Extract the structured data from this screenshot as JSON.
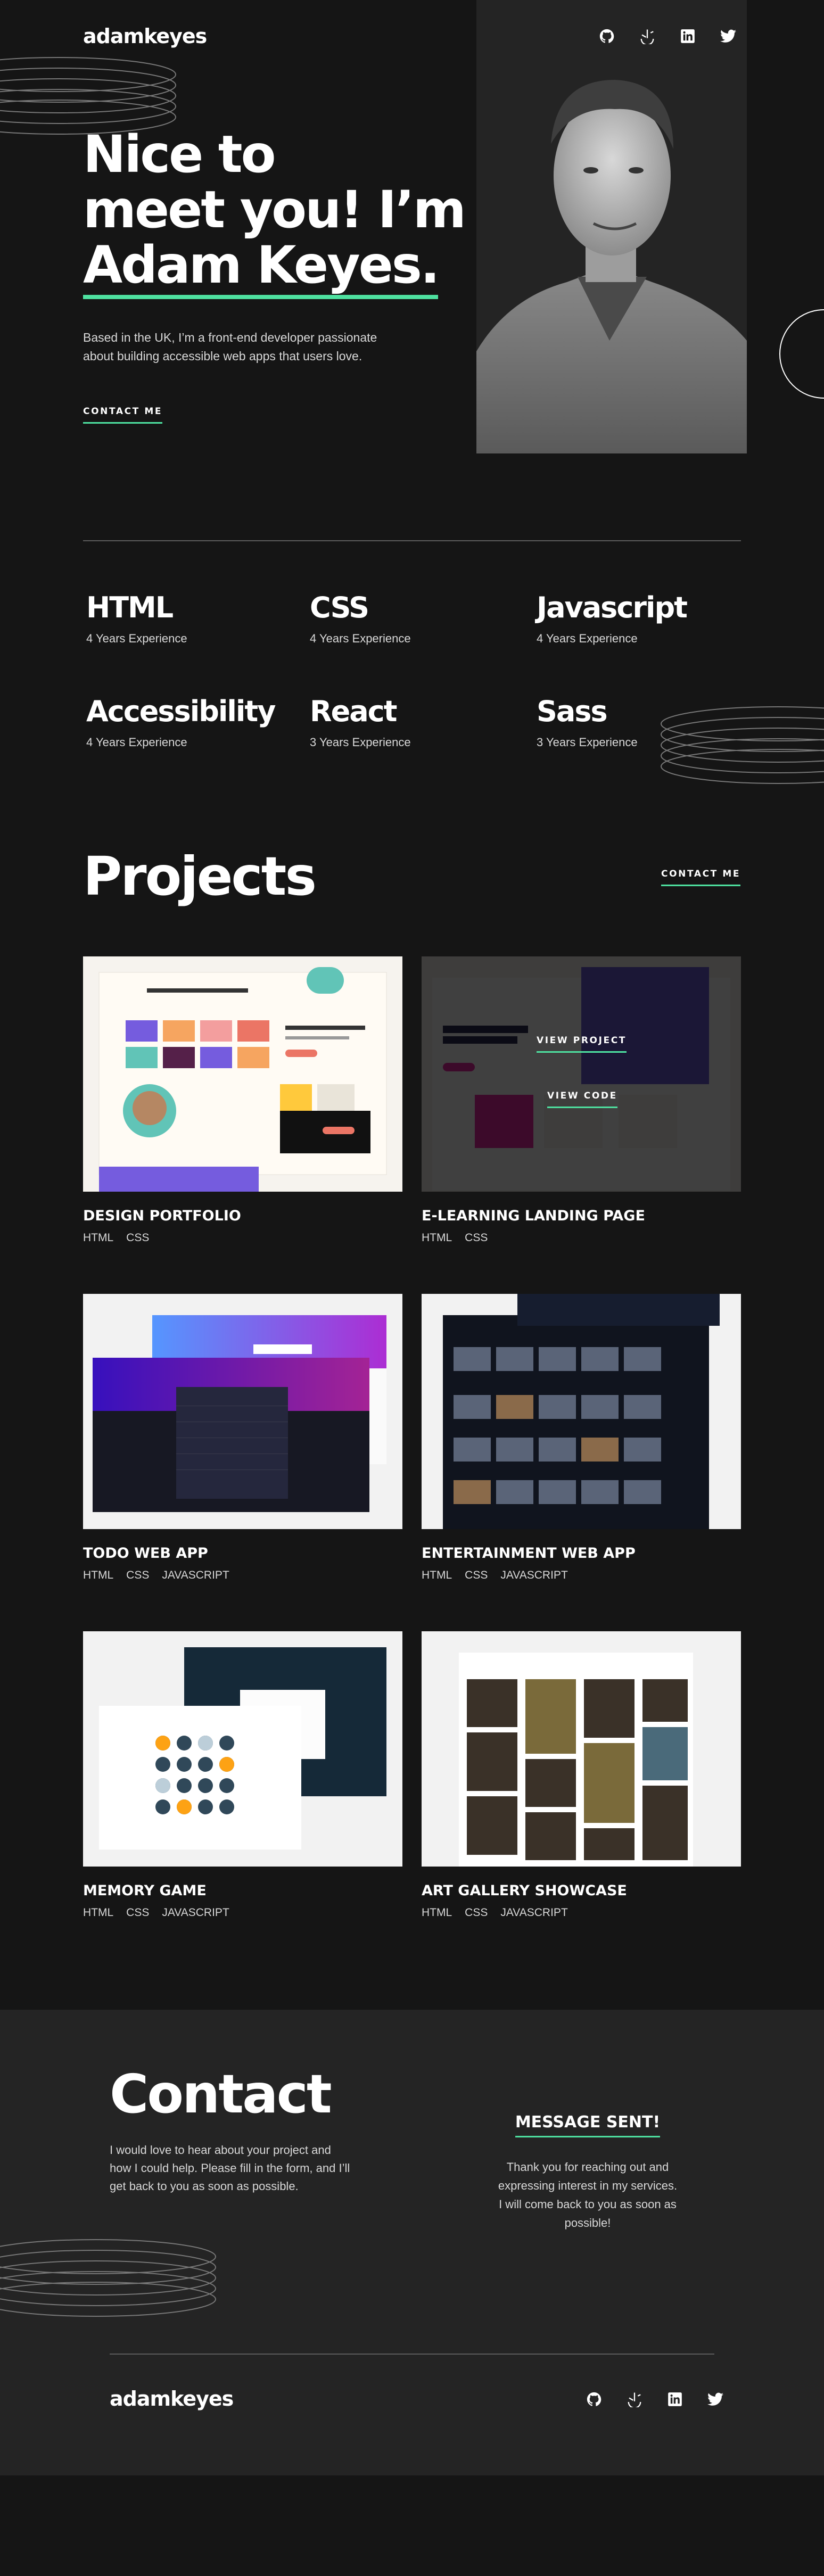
{
  "header": {
    "logo": "adamkeyes",
    "social": [
      "github-icon",
      "frontend-mentor-icon",
      "linkedin-icon",
      "twitter-icon"
    ]
  },
  "hero": {
    "line1": "Nice to",
    "line2": "meet you! I’m",
    "name": "Adam Keyes.",
    "description_line1": "Based in the UK, I’m a front-end developer passionate",
    "description_line2": "about building accessible web apps that users love.",
    "cta": "CONTACT ME"
  },
  "skills": [
    {
      "name": "HTML",
      "experience": "4 Years Experience"
    },
    {
      "name": "CSS",
      "experience": "4 Years Experience"
    },
    {
      "name": "Javascript",
      "experience": "4 Years Experience"
    },
    {
      "name": "Accessibility",
      "experience": "4 Years Experience"
    },
    {
      "name": "React",
      "experience": "3 Years Experience"
    },
    {
      "name": "Sass",
      "experience": "3 Years Experience"
    }
  ],
  "projects": {
    "title": "Projects",
    "cta": "CONTACT ME",
    "view_project": "VIEW PROJECT",
    "view_code": "VIEW CODE",
    "items": [
      {
        "name": "DESIGN PORTFOLIO",
        "tags": [
          "HTML",
          "CSS"
        ]
      },
      {
        "name": "E-LEARNING LANDING PAGE",
        "tags": [
          "HTML",
          "CSS"
        ]
      },
      {
        "name": "TODO WEB APP",
        "tags": [
          "HTML",
          "CSS",
          "JAVASCRIPT"
        ]
      },
      {
        "name": "ENTERTAINMENT WEB APP",
        "tags": [
          "HTML",
          "CSS",
          "JAVASCRIPT"
        ]
      },
      {
        "name": "MEMORY GAME",
        "tags": [
          "HTML",
          "CSS",
          "JAVASCRIPT"
        ]
      },
      {
        "name": "ART GALLERY SHOWCASE",
        "tags": [
          "HTML",
          "CSS",
          "JAVASCRIPT"
        ]
      }
    ]
  },
  "contact": {
    "title": "Contact",
    "desc_line1": "I would love to hear about your project and",
    "desc_line2": "how I could help. Please fill in the form, and I’ll",
    "desc_line3": "get back to you as soon as possible.",
    "sent_title": "MESSAGE SENT!",
    "sent_line1": "Thank you for reaching out and",
    "sent_line2": "expressing interest in my services.",
    "sent_line3": "I will come back to you as soon as",
    "sent_line4": "possible!"
  },
  "footer": {
    "logo": "adamkeyes"
  },
  "colors": {
    "accent": "#4EE1A0",
    "background": "#151515",
    "panel": "#242424"
  }
}
